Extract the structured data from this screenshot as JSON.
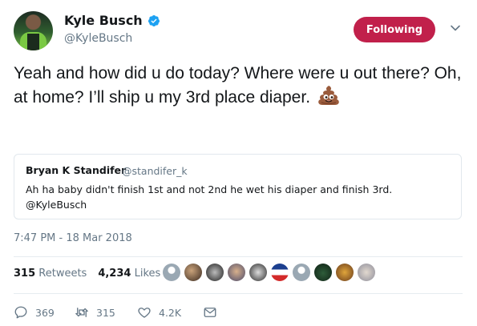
{
  "author": {
    "name": "Kyle Busch",
    "handle": "@KyleBusch",
    "verified": true
  },
  "follow_button": {
    "label": "Following",
    "color": "#c1204b"
  },
  "tweet": {
    "text": "Yeah and how did u do today? Where were u out there? Oh, at home? I’ll ship u my 3rd place diaper.",
    "emoji": "pile-of-poo-icon"
  },
  "quoted_tweet": {
    "name": "Bryan K Standifer",
    "handle": "@standifer_k",
    "text": "Ah ha baby didn't finish 1st and not 2nd he wet his diaper and finish 3rd. @KyleBusch"
  },
  "timestamp": "7:47 PM - 18 Mar 2018",
  "stats": {
    "retweets_count": "315",
    "retweets_label": "Retweets",
    "likes_count": "4,234",
    "likes_label": "Likes"
  },
  "likers": [
    "avatar-1",
    "avatar-2",
    "avatar-3",
    "avatar-4",
    "avatar-5",
    "avatar-6",
    "avatar-7",
    "avatar-8",
    "avatar-9",
    "avatar-10"
  ],
  "actions": {
    "replies": "369",
    "retweets": "315",
    "likes": "4.2K"
  }
}
